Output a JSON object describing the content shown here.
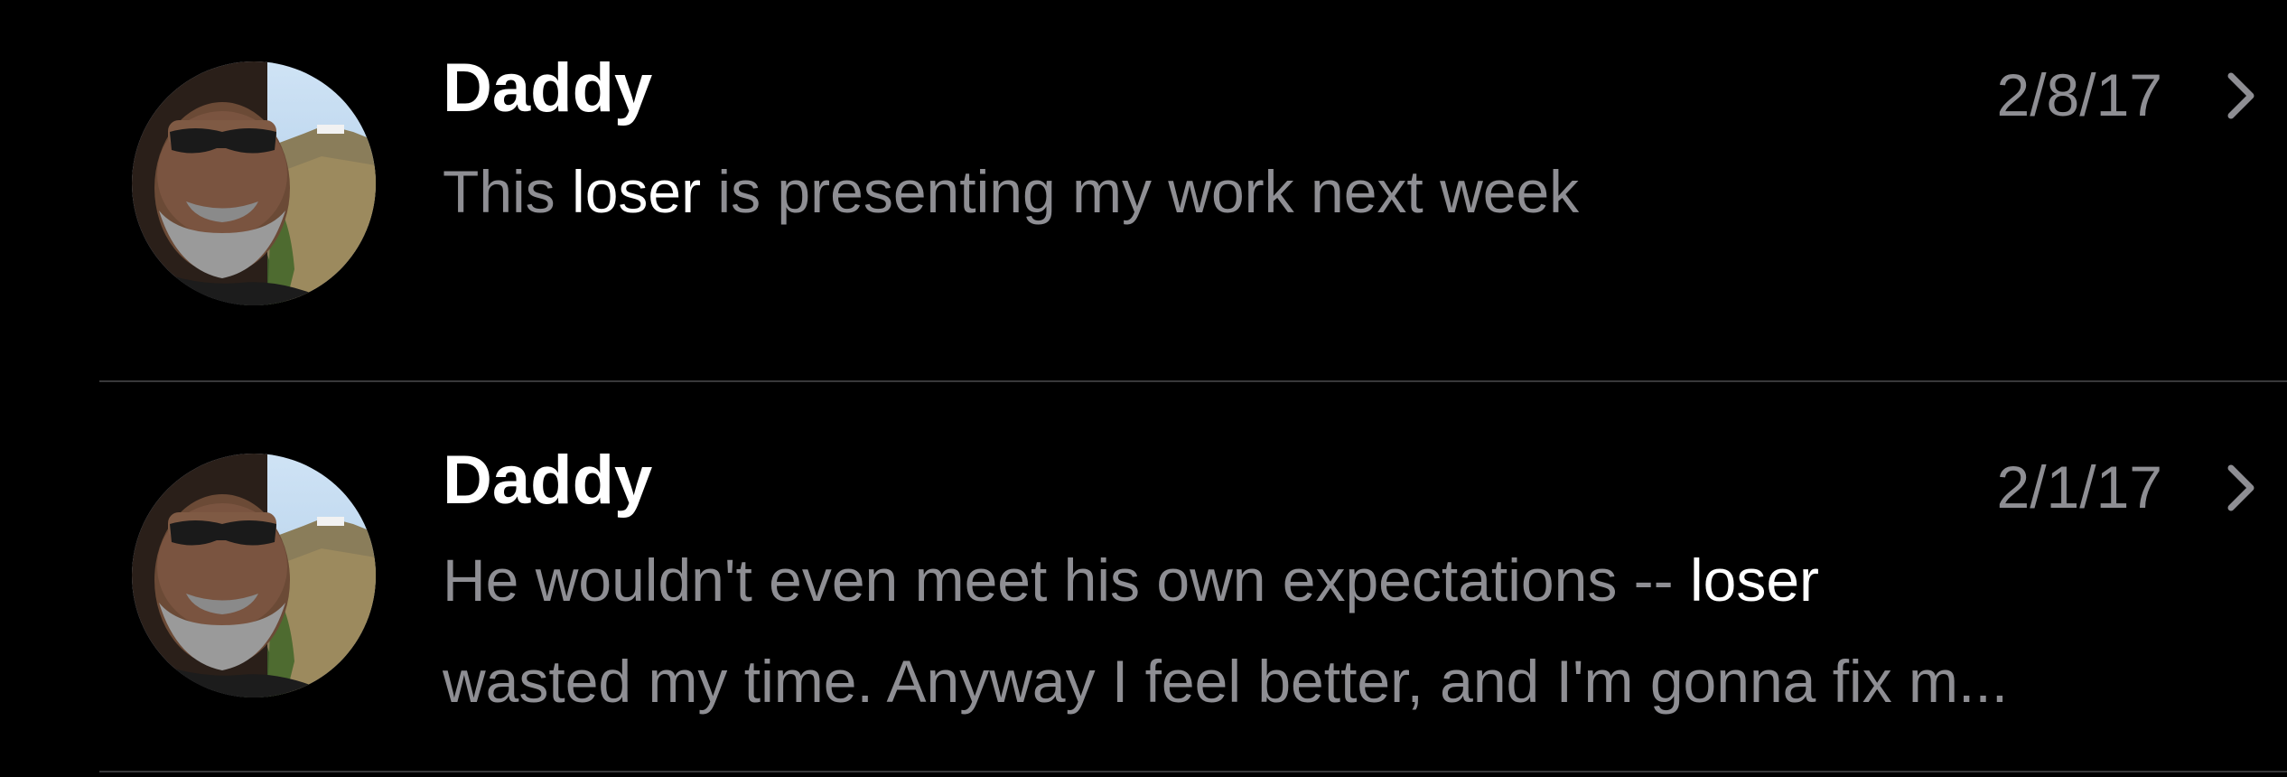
{
  "messages": [
    {
      "sender": "Daddy",
      "date": "2/8/17",
      "preview": {
        "before": "This ",
        "highlight": "loser",
        "after": " is presenting my work next week"
      }
    },
    {
      "sender": "Daddy",
      "date": "2/1/17",
      "preview": {
        "line1_before": "He wouldn't even meet his own expectations -- ",
        "highlight": "loser",
        "line2": "wasted my time. Anyway I feel better, and I'm gonna fix m..."
      }
    }
  ],
  "icons": {
    "avatar": "contact-photo-icon",
    "chevron": "chevron-right-icon"
  },
  "colors": {
    "background": "#000000",
    "primary_text": "#ffffff",
    "secondary_text": "#8e8e93",
    "separator": "#38383a"
  }
}
